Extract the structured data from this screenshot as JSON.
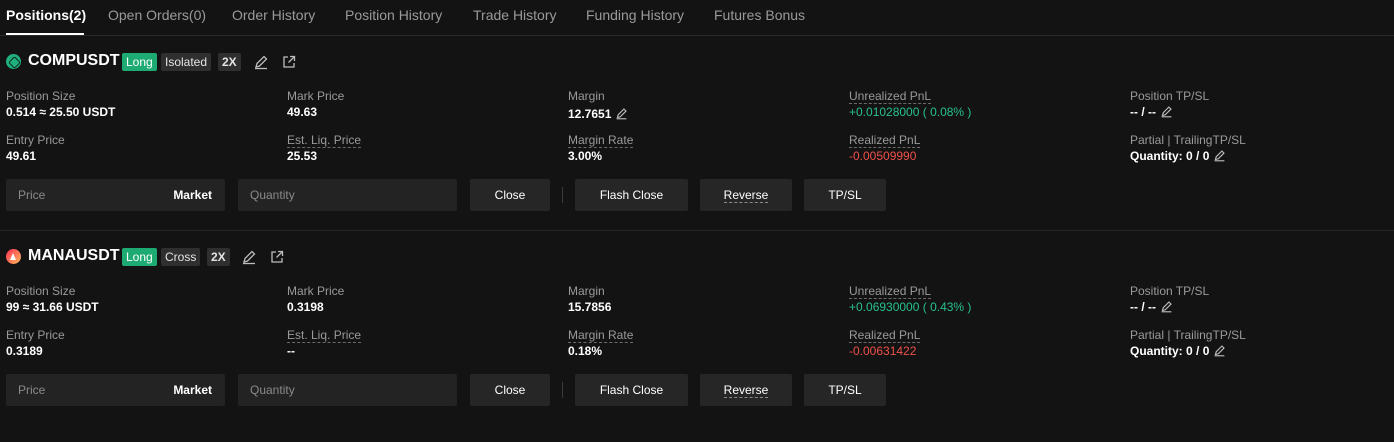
{
  "tabs": [
    {
      "label": "Positions(2)",
      "active": true
    },
    {
      "label": "Open Orders(0)"
    },
    {
      "label": "Order History"
    },
    {
      "label": "Position History"
    },
    {
      "label": "Trade History"
    },
    {
      "label": "Funding History"
    },
    {
      "label": "Futures Bonus"
    }
  ],
  "labels": {
    "position_size": "Position Size",
    "mark_price": "Mark Price",
    "margin": "Margin",
    "unrealized_pnl": "Unrealized PnL",
    "position_tpsl": "Position TP/SL",
    "entry_price": "Entry Price",
    "est_liq_price": "Est. Liq. Price",
    "margin_rate": "Margin Rate",
    "realized_pnl": "Realized PnL",
    "partial_trailing": "Partial | TrailingTP/SL",
    "quantity_prefix": "Quantity:"
  },
  "controls": {
    "price_placeholder": "Price",
    "market_label": "Market",
    "quantity_placeholder": "Quantity",
    "close_label": "Close",
    "flash_close_label": "Flash Close",
    "reverse_label": "Reverse",
    "tpsl_label": "TP/SL"
  },
  "positions": [
    {
      "symbol": "COMPUSDT",
      "side": "Long",
      "margin_mode": "Isolated",
      "leverage": "2X",
      "position_size": "0.514 ≈ 25.50 USDT",
      "mark_price": "49.63",
      "margin": "12.7651",
      "unrealized_pnl": "+0.01028000 ( 0.08% )",
      "position_tpsl": "-- / --",
      "entry_price": "49.61",
      "est_liq_price": "25.53",
      "margin_rate": "3.00%",
      "realized_pnl": "-0.00509990",
      "quantity": "0 / 0"
    },
    {
      "symbol": "MANAUSDT",
      "side": "Long",
      "margin_mode": "Cross",
      "leverage": "2X",
      "position_size": "99 ≈ 31.66 USDT",
      "mark_price": "0.3198",
      "margin": "15.7856",
      "unrealized_pnl": "+0.06930000 ( 0.43% )",
      "position_tpsl": "-- / --",
      "entry_price": "0.3189",
      "est_liq_price": "--",
      "margin_rate": "0.18%",
      "realized_pnl": "-0.00631422",
      "quantity": "0 / 0"
    }
  ],
  "colors": {
    "background": "#131313",
    "long_badge": "#1eab73",
    "profit": "#27c28b",
    "loss": "#f0504a"
  }
}
